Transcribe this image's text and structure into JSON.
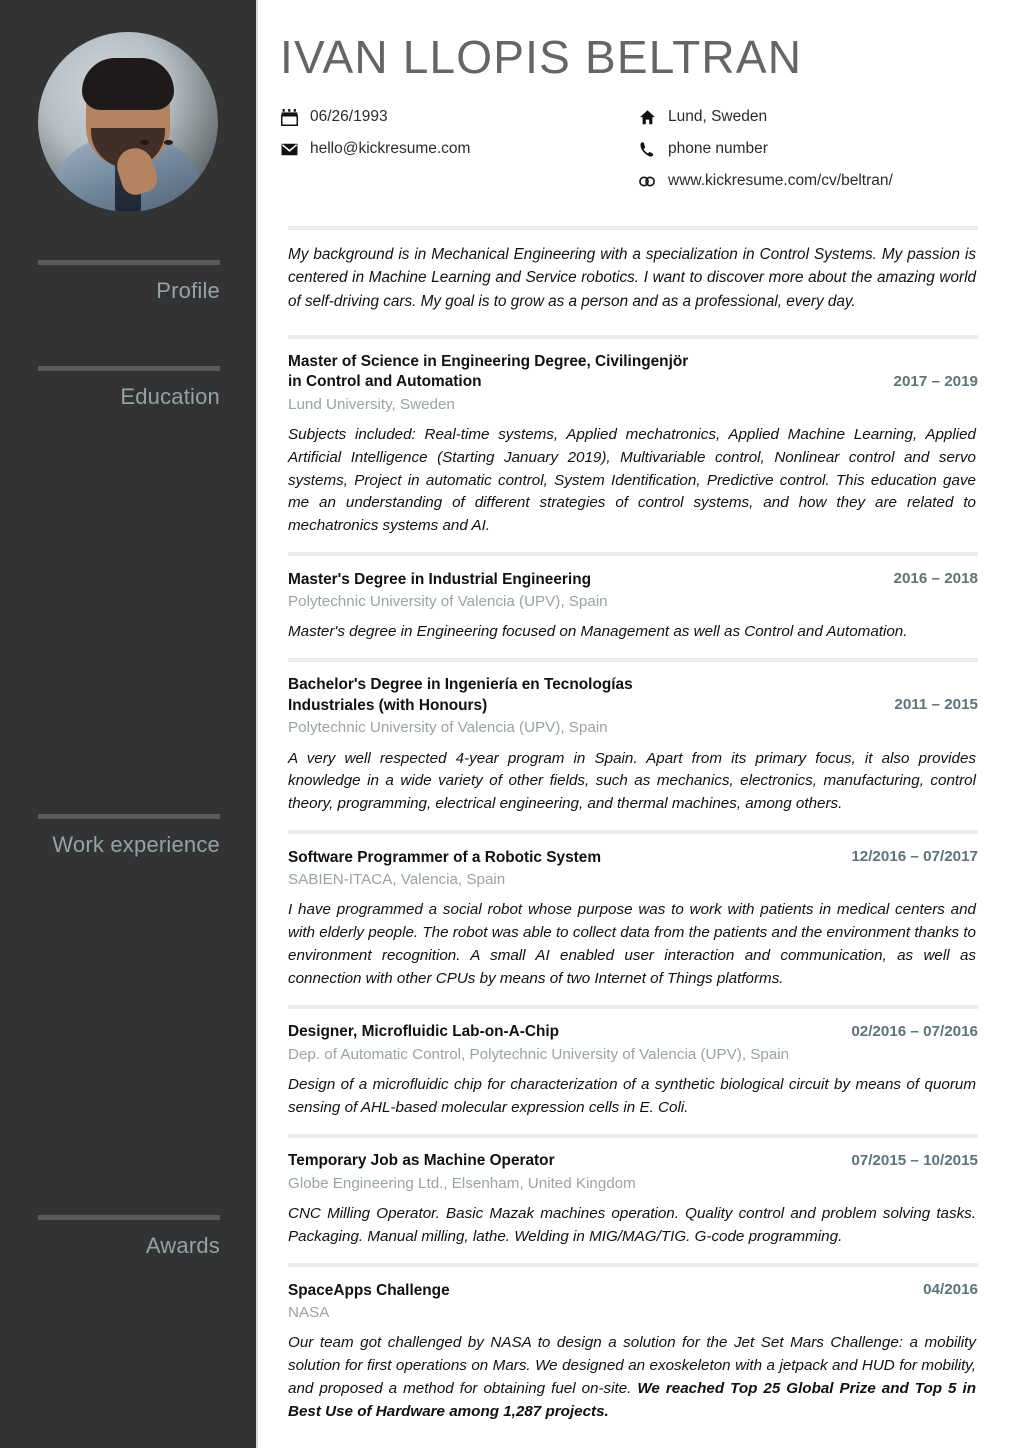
{
  "person": {
    "name": "IVAN LLOPIS BELTRAN"
  },
  "contact": {
    "left": [
      {
        "icon": "calendar-icon",
        "value": "06/26/1993"
      },
      {
        "icon": "envelope-icon",
        "value": "hello@kickresume.com"
      }
    ],
    "right": [
      {
        "icon": "home-icon",
        "value": "Lund, Sweden"
      },
      {
        "icon": "phone-icon",
        "value": "phone number"
      },
      {
        "icon": "link-icon",
        "value": "www.kickresume.com/cv/beltran/"
      }
    ]
  },
  "sidebar": {
    "sections": [
      {
        "label": "Profile"
      },
      {
        "label": "Education"
      },
      {
        "label": "Work experience"
      },
      {
        "label": "Awards"
      }
    ]
  },
  "profile": {
    "text": "My background is in Mechanical Engineering with a specialization in Control Systems. My passion is centered in Machine Learning and Service robotics. I want to discover more about the amazing world of self-driving cars. My goal is to grow as a person and as a professional, every day."
  },
  "education": [
    {
      "title": "Master of Science in Engineering Degree, Civilingenjör\nin Control and Automation",
      "date": "2017 – 2019",
      "subtitle": "Lund University, Sweden",
      "description": "Subjects included: Real-time systems, Applied mechatronics, Applied Machine Learning, Applied Artificial Intelligence (Starting January 2019), Multivariable control, Nonlinear control and servo systems, Project in automatic control, System Identification, Predictive control. This education gave me an understanding of different strategies of control systems, and how they are related to mechatronics systems and AI."
    },
    {
      "title": "Master's Degree in Industrial Engineering",
      "date": "2016 – 2018",
      "subtitle": "Polytechnic University of Valencia (UPV), Spain",
      "description": "Master's degree in Engineering focused on Management as well as Control and Automation."
    },
    {
      "title": "Bachelor's Degree in Ingeniería en Tecnologías\nIndustriales (with Honours)",
      "date": "2011 – 2015",
      "subtitle": "Polytechnic University of Valencia (UPV), Spain",
      "description": "A very well respected 4-year program in Spain. Apart from its primary focus, it also provides knowledge in a wide variety of other fields, such as mechanics, electronics, manufacturing, control theory, programming, electrical engineering, and thermal machines, among others."
    }
  ],
  "work_experience": [
    {
      "title": "Software Programmer of a Robotic System",
      "date": "12/2016 – 07/2017",
      "subtitle": "SABIEN-ITACA, Valencia, Spain",
      "description": "I have programmed a social robot whose purpose was to work with patients in medical centers and with elderly people. The robot was able to collect data from the patients and the environment thanks to environment recognition. A small AI enabled user interaction and communication, as well as connection with other CPUs by means of two Internet of Things platforms."
    },
    {
      "title": "Designer, Microfluidic Lab-on-A-Chip",
      "date": "02/2016 – 07/2016",
      "subtitle": "Dep. of Automatic Control, Polytechnic University of Valencia (UPV), Spain",
      "description": "Design of a microfluidic chip for characterization of a synthetic biological circuit by means of quorum sensing of AHL-based molecular expression cells in E. Coli."
    },
    {
      "title": "Temporary Job as Machine Operator",
      "date": "07/2015 – 10/2015",
      "subtitle": "Globe Engineering Ltd., Elsenham, United Kingdom",
      "description": "CNC Milling Operator. Basic Mazak machines operation. Quality control and problem solving tasks. Packaging. Manual milling, lathe. Welding in MIG/MAG/TIG. G-code programming."
    }
  ],
  "awards": [
    {
      "title": "SpaceApps Challenge",
      "date": "04/2016",
      "subtitle": "NASA",
      "description_plain": "Our team got challenged by NASA to design a solution for the Jet Set Mars Challenge: a mobility solution for first operations on Mars. We designed an exoskeleton with a jetpack and HUD for mobility, and proposed a method for obtaining fuel on-site. ",
      "description_bold": "We reached Top 25 Global Prize and Top 5 in Best Use of Hardware among 1,287 projects."
    }
  ],
  "colors": {
    "sidebar_bg": "#333333",
    "sidebar_label": "#93a3a6",
    "name": "#656565",
    "date": "#5c7379",
    "subtitle": "#9aa3a5",
    "divider": "#ececec"
  }
}
